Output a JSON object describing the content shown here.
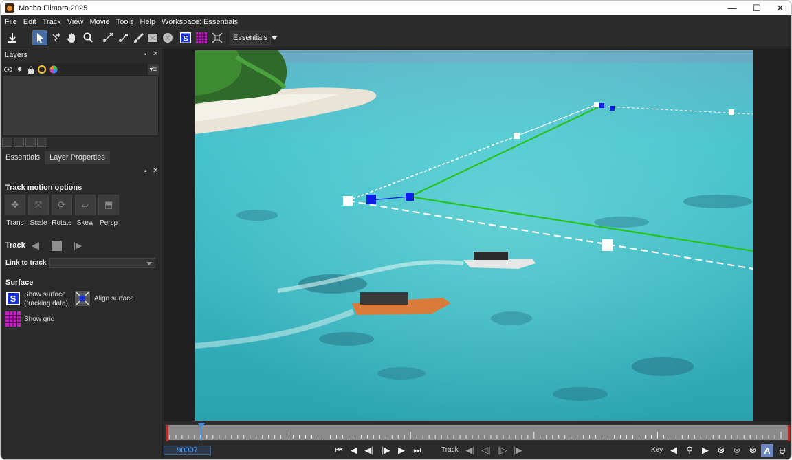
{
  "window": {
    "title": "Mocha Filmora 2025",
    "minimize": "—",
    "maximize": "☐",
    "close": "✕"
  },
  "menu": [
    "File",
    "Edit",
    "Track",
    "View",
    "Movie",
    "Tools",
    "Help",
    "Workspace: Essentials"
  ],
  "toolbar": {
    "workspace_dropdown": "Essentials"
  },
  "layers_panel": {
    "title": "Layers"
  },
  "tabs": {
    "essentials": "Essentials",
    "layer_properties": "Layer Properties"
  },
  "track_motion": {
    "title": "Track motion options",
    "buttons": [
      "Trans",
      "Scale",
      "Rotate",
      "Skew",
      "Persp"
    ]
  },
  "track": {
    "label": "Track"
  },
  "link_to_track": {
    "label": "Link to track",
    "value": ""
  },
  "surface": {
    "title": "Surface",
    "show_surface_line1": "Show surface",
    "show_surface_line2": "(tracking data)",
    "align_surface": "Align surface",
    "show_grid": "Show grid",
    "surface_icon_letter": "S"
  },
  "timeline": {
    "current_frame": "90007",
    "track_label": "Track",
    "key_label": "Key"
  },
  "colors": {
    "accent": "#3d8ee6",
    "track_green": "#27c31d",
    "point_blue": "#0a1ee6",
    "grid_magenta": "#c020c0"
  }
}
